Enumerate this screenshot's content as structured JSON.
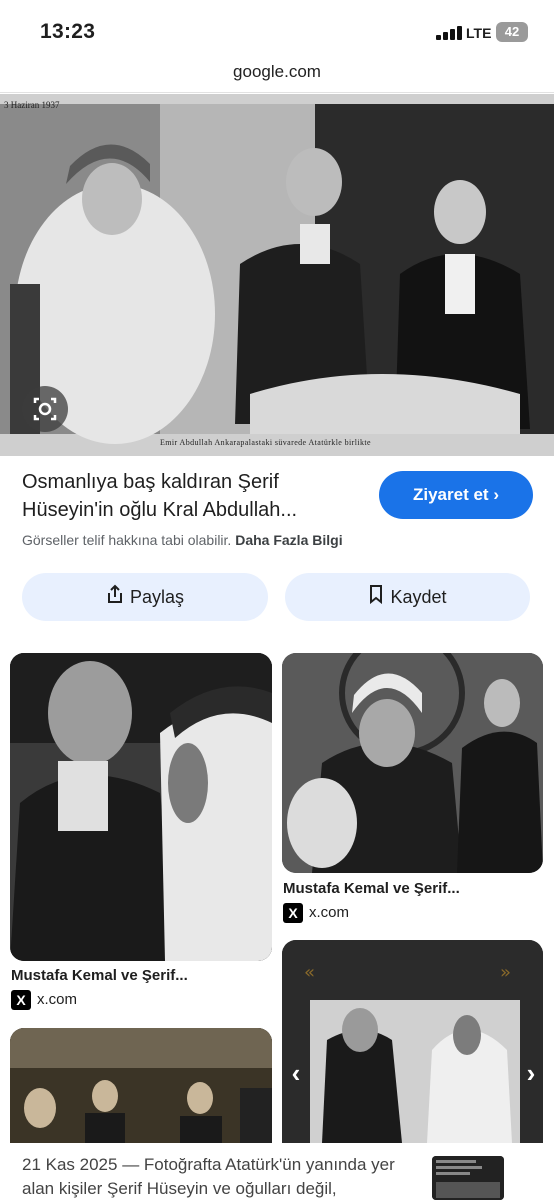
{
  "status": {
    "time": "13:23",
    "network": "LTE",
    "battery": "42"
  },
  "url": "google.com",
  "hero": {
    "date_stamp": "3 Haziran 1937",
    "caption": "Emir Abdullah Ankarapalastaki süvarede Atatürkle birlikte",
    "lens_icon": "google-lens-icon"
  },
  "result": {
    "title": "Osmanlıya baş kaldıran Şerif Hüseyin'in oğlu Kral Abdullah...",
    "visit_label": "Ziyaret et",
    "copyright_text": "Görseller telif hakkına tabi olabilir.",
    "more_info": "Daha Fazla Bilgi"
  },
  "actions": {
    "share_label": "Paylaş",
    "save_label": "Kaydet"
  },
  "grid": [
    {
      "caption": "Mustafa Kemal ve Şerif...",
      "source": "x.com"
    },
    {
      "caption": "Mustafa Kemal ve Şerif...",
      "source": "x.com"
    }
  ],
  "news": {
    "text": "21 Kas 2025 — Fotoğrafta Atatürk'ün yanında yer alan kişiler Şerif Hüseyin ve oğulları değil,"
  },
  "colors": {
    "accent": "#1a73e8",
    "pill_bg": "#e8f0fe"
  }
}
